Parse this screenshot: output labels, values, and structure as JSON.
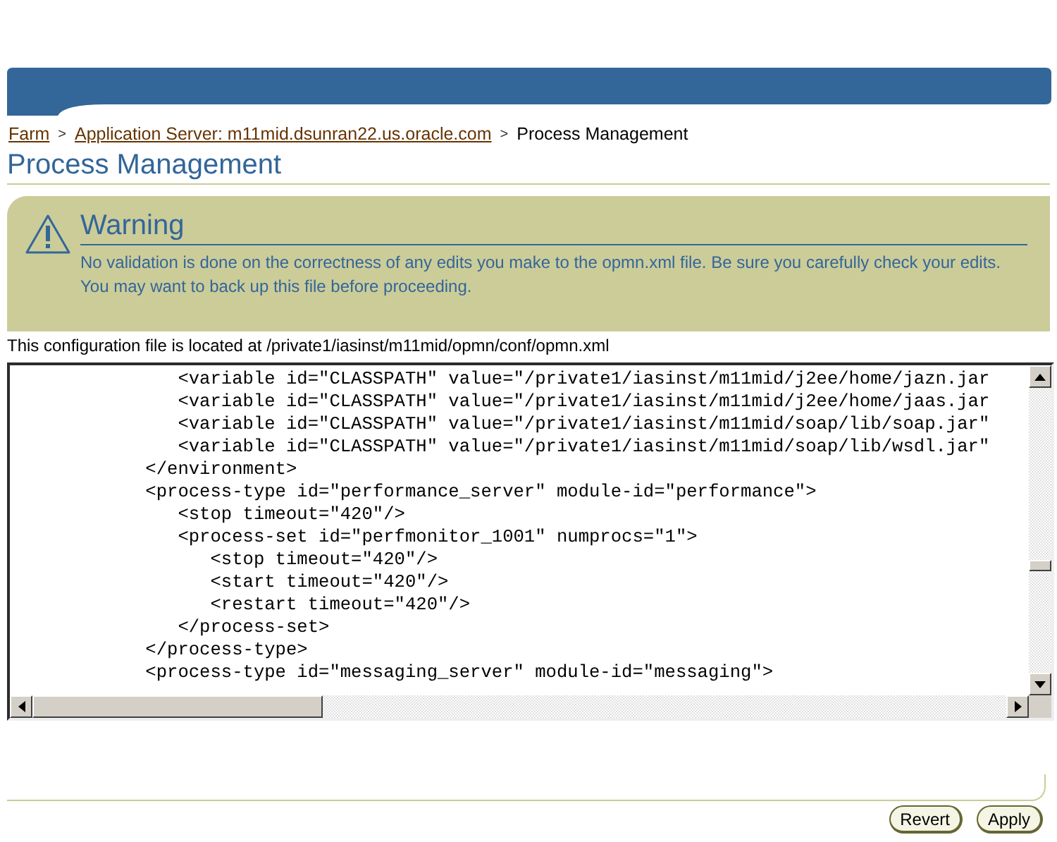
{
  "breadcrumbs": [
    {
      "label": "Farm",
      "link": true
    },
    {
      "label": "Application Server: m11mid.dsunran22.us.oracle.com",
      "link": true
    },
    {
      "label": "Process Management",
      "link": false
    }
  ],
  "breadcrumb_separator": ">",
  "title": "Process Management",
  "warning": {
    "heading": "Warning",
    "message": "No validation is done on the correctness of any edits you make to the opmn.xml file. Be sure you carefully check your edits. You may want to back up this file before proceeding."
  },
  "config_note": "This configuration file is located at /private1/iasinst/m11mid/opmn/conf/opmn.xml",
  "editor_lines": [
    "               <variable id=\"CLASSPATH\" value=\"/private1/iasinst/m11mid/j2ee/home/jazn.jar",
    "               <variable id=\"CLASSPATH\" value=\"/private1/iasinst/m11mid/j2ee/home/jaas.jar",
    "               <variable id=\"CLASSPATH\" value=\"/private1/iasinst/m11mid/soap/lib/soap.jar\"",
    "               <variable id=\"CLASSPATH\" value=\"/private1/iasinst/m11mid/soap/lib/wsdl.jar\"",
    "            </environment>",
    "            <process-type id=\"performance_server\" module-id=\"performance\">",
    "               <stop timeout=\"420\"/>",
    "               <process-set id=\"perfmonitor_1001\" numprocs=\"1\">",
    "                  <stop timeout=\"420\"/>",
    "                  <start timeout=\"420\"/>",
    "                  <restart timeout=\"420\"/>",
    "               </process-set>",
    "            </process-type>",
    "            <process-type id=\"messaging_server\" module-id=\"messaging\">"
  ],
  "buttons": [
    "Revert",
    "Apply"
  ]
}
